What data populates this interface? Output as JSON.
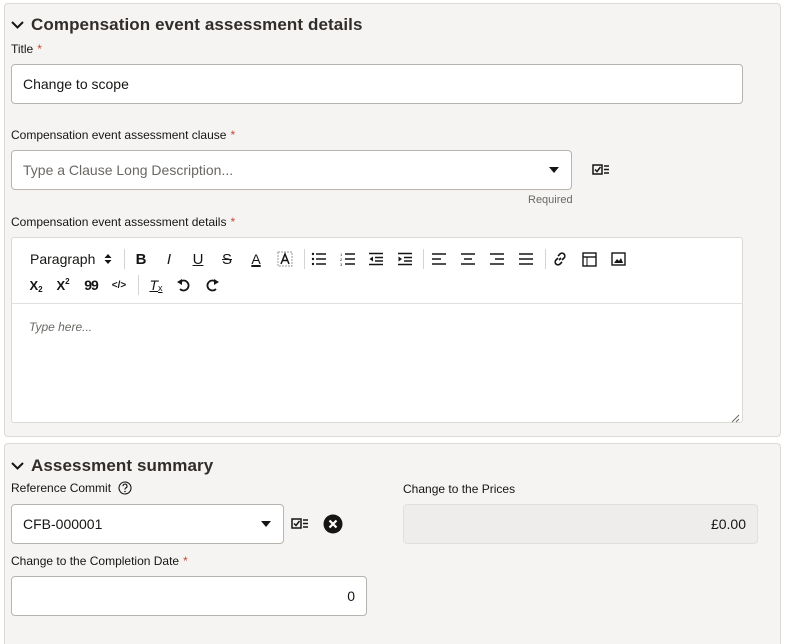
{
  "section1": {
    "title": "Compensation event assessment details",
    "title_field": {
      "label": "Title",
      "value": "Change to scope"
    },
    "clause_field": {
      "label": "Compensation event assessment clause",
      "placeholder": "Type a Clause Long Description...",
      "helper": "Required"
    },
    "details_field": {
      "label": "Compensation event assessment details",
      "toolbar": {
        "paragraph": "Paragraph",
        "bold": "B",
        "italic": "I",
        "underline": "U",
        "strike": "S",
        "font_color": "A",
        "subscript": "X",
        "subscript_mark": "2",
        "superscript": "X",
        "superscript_mark": "2",
        "blockquote": "99",
        "code": "</>",
        "clear_format": "T"
      },
      "placeholder": "Type here..."
    }
  },
  "section2": {
    "title": "Assessment summary",
    "reference_commit": {
      "label": "Reference Commit",
      "value": "CFB-000001"
    },
    "change_prices": {
      "label": "Change to the Prices",
      "value": "£0.00"
    },
    "change_completion": {
      "label": "Change to the Completion Date",
      "value": "0"
    }
  },
  "colors": {
    "required": "#c74634",
    "panel": "#f5f4f2",
    "border": "#b8b5b0",
    "text": "#161513"
  }
}
